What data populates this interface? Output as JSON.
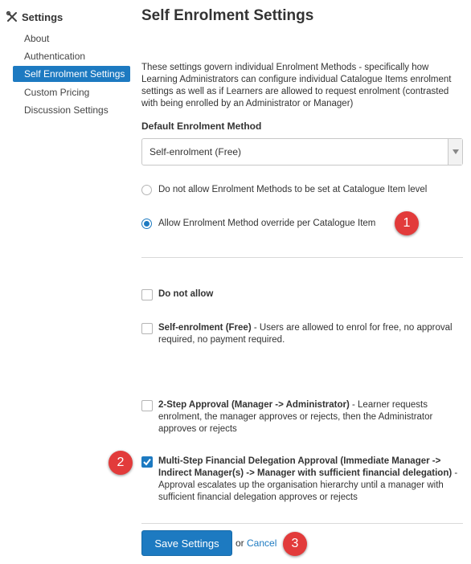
{
  "sidebar": {
    "title": "Settings",
    "items": [
      {
        "label": "About",
        "active": false
      },
      {
        "label": "Authentication",
        "active": false
      },
      {
        "label": "Self Enrolment Settings",
        "active": true
      },
      {
        "label": "Custom Pricing",
        "active": false
      },
      {
        "label": "Discussion Settings",
        "active": false
      }
    ]
  },
  "main": {
    "title": "Self Enrolment Settings",
    "description": "These settings govern individual Enrolment Methods - specifically how Learning Administrators can configure individual Catalogue Items enrolment settings as well as if Learners are allowed to request enrolment (contrasted with being enrolled by an Administrator or Manager)",
    "default_method_label": "Default Enrolment Method",
    "default_method_value": "Self-enrolment (Free)",
    "radio_options": [
      {
        "label": "Do not allow Enrolment Methods to be set at Catalogue Item level",
        "checked": false
      },
      {
        "label": "Allow Enrolment Method override per Catalogue Item",
        "checked": true
      }
    ],
    "checkboxes": [
      {
        "bold": "Do not allow",
        "text": "",
        "checked": false
      },
      {
        "bold": "Self-enrolment (Free)",
        "text": " - Users are allowed to enrol for free, no approval required, no payment required.",
        "checked": false
      },
      {
        "bold": "2-Step Approval (Manager -> Administrator)",
        "text": " - Learner requests enrolment, the manager approves or rejects, then the Administrator approves or rejects",
        "checked": false
      },
      {
        "bold": "Multi-Step Financial Delegation Approval (Immediate Manager -> Indirect Manager(s) -> Manager with sufficient financial delegation)",
        "text": " - Approval escalates up the organisation hierarchy until a manager with sufficient financial delegation approves or rejects",
        "checked": true
      }
    ],
    "save_label": "Save Settings",
    "or_text": "or",
    "cancel_label": "Cancel"
  },
  "callouts": [
    "1",
    "2",
    "3"
  ],
  "colors": {
    "accent": "#1d7ac1",
    "callout": "#e23b3b"
  }
}
